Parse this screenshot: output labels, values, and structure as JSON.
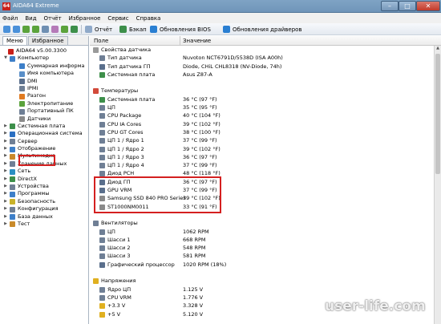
{
  "window": {
    "title": "AIDA64 Extreme",
    "app_icon": "64"
  },
  "menu": [
    "Файл",
    "Вид",
    "Отчёт",
    "Избранное",
    "Сервис",
    "Справка"
  ],
  "toolbar": {
    "report_label": "Отчёт",
    "backup_label": "Бэкап",
    "bios_label": "Обновления BIOS",
    "drivers_label": "Обновления драйверов"
  },
  "left_tabs": [
    "Меню",
    "Избранное"
  ],
  "tree": [
    {
      "label": "AIDA64 v5.00.3300",
      "level": 0,
      "icon": "aida-icon",
      "color": "#c8201a"
    },
    {
      "label": "Компьютер",
      "level": 1,
      "icon": "computer-icon",
      "color": "#3d7fc9",
      "exp": "▼"
    },
    {
      "label": "Суммарная информа",
      "level": 2,
      "icon": "info-icon",
      "color": "#3d7fc9"
    },
    {
      "label": "Имя компьютера",
      "level": 2,
      "icon": "computer-icon",
      "color": "#5a8fc8"
    },
    {
      "label": "DMI",
      "level": 2,
      "icon": "chip-icon",
      "color": "#5a6f8c"
    },
    {
      "label": "IPMI",
      "level": 2,
      "icon": "chip-icon",
      "color": "#6f7f95"
    },
    {
      "label": "Разгон",
      "level": 2,
      "icon": "flame-icon",
      "color": "#e07a20"
    },
    {
      "label": "Электропитание",
      "level": 2,
      "icon": "power-icon",
      "color": "#5ba33c"
    },
    {
      "label": "Портативный ПК",
      "level": 2,
      "icon": "laptop-icon",
      "color": "#6f7f95"
    },
    {
      "label": "Датчики",
      "level": 2,
      "icon": "sensor-icon",
      "color": "#8a8a8a"
    },
    {
      "label": "Системная плата",
      "level": 1,
      "icon": "motherboard-icon",
      "color": "#3d8f4a",
      "exp": "▶"
    },
    {
      "label": "Операционная система",
      "level": 1,
      "icon": "windows-icon",
      "color": "#2a6fc2",
      "exp": "▶"
    },
    {
      "label": "Сервер",
      "level": 1,
      "icon": "server-icon",
      "color": "#6f7f95",
      "exp": "▶"
    },
    {
      "label": "Отображение",
      "level": 1,
      "icon": "display-icon",
      "color": "#3d7fc9",
      "exp": "▶"
    },
    {
      "label": "Мультимедиа",
      "level": 1,
      "icon": "multimedia-icon",
      "color": "#c9882a",
      "exp": "▶"
    },
    {
      "label": "Хранение данных",
      "level": 1,
      "icon": "storage-icon",
      "color": "#6f7f95",
      "exp": "▶"
    },
    {
      "label": "Сеть",
      "level": 1,
      "icon": "network-icon",
      "color": "#2a8fc2",
      "exp": "▶"
    },
    {
      "label": "DirectX",
      "level": 1,
      "icon": "directx-icon",
      "color": "#3d8f4a",
      "exp": "▶"
    },
    {
      "label": "Устройства",
      "level": 1,
      "icon": "devices-icon",
      "color": "#6f7f95",
      "exp": "▶"
    },
    {
      "label": "Программы",
      "level": 1,
      "icon": "programs-icon",
      "color": "#3d7fc9",
      "exp": "▶"
    },
    {
      "label": "Безопасность",
      "level": 1,
      "icon": "security-icon",
      "color": "#c9b22a",
      "exp": "▶"
    },
    {
      "label": "Конфигурация",
      "level": 1,
      "icon": "config-icon",
      "color": "#6f7f95",
      "exp": "▶"
    },
    {
      "label": "База данных",
      "level": 1,
      "icon": "database-icon",
      "color": "#3d7fc9",
      "exp": "▶"
    },
    {
      "label": "Тест",
      "level": 1,
      "icon": "test-icon",
      "color": "#c98a2a",
      "exp": "▶"
    }
  ],
  "columns": {
    "field": "Поле",
    "value": "Значение"
  },
  "rows": [
    {
      "type": "group",
      "field": "Свойства датчика",
      "icon": "sensor-icon",
      "color": "#9a9a9a"
    },
    {
      "field": "Тип датчика",
      "value": "Nuvoton NCT6791D/5538D  (ISA A00h)",
      "icon": "chip-icon",
      "color": "#6f7f95"
    },
    {
      "field": "Тип датчика ГП",
      "value": "Diode, CHiL CHL8318  (NV-Diode, 74h)",
      "icon": "gpu-icon",
      "color": "#5a6f8c"
    },
    {
      "field": "Системная плата",
      "value": "Asus Z87-A",
      "icon": "motherboard-icon",
      "color": "#3d8f4a"
    },
    {
      "type": "blank"
    },
    {
      "type": "group",
      "field": "Температуры",
      "icon": "thermometer-icon",
      "color": "#d24a3a"
    },
    {
      "field": "Системная плата",
      "value": "36 °C  (97 °F)",
      "icon": "motherboard-icon",
      "color": "#3d8f4a"
    },
    {
      "field": "ЦП",
      "value": "35 °C  (95 °F)",
      "icon": "cpu-icon",
      "color": "#6f7f95"
    },
    {
      "field": "CPU Package",
      "value": "40 °C  (104 °F)",
      "icon": "cpu-icon",
      "color": "#6f7f95"
    },
    {
      "field": "CPU IA Cores",
      "value": "39 °C  (102 °F)",
      "icon": "cpu-icon",
      "color": "#6f7f95"
    },
    {
      "field": "CPU GT Cores",
      "value": "38 °C  (100 °F)",
      "icon": "cpu-icon",
      "color": "#6f7f95"
    },
    {
      "field": "ЦП 1 / Ядро 1",
      "value": "37 °C  (99 °F)",
      "icon": "cpu-icon",
      "color": "#6f7f95"
    },
    {
      "field": "ЦП 1 / Ядро 2",
      "value": "39 °C  (102 °F)",
      "icon": "cpu-icon",
      "color": "#6f7f95"
    },
    {
      "field": "ЦП 1 / Ядро 3",
      "value": "36 °C  (97 °F)",
      "icon": "cpu-icon",
      "color": "#6f7f95"
    },
    {
      "field": "ЦП 1 / Ядро 4",
      "value": "37 °C  (99 °F)",
      "icon": "cpu-icon",
      "color": "#6f7f95"
    },
    {
      "field": "Диод PCH",
      "value": "48 °C  (118 °F)",
      "icon": "chip-icon",
      "color": "#6f7f95"
    },
    {
      "field": "Диод ГП",
      "value": "36 °C  (97 °F)",
      "icon": "gpu-icon",
      "color": "#5a6f8c"
    },
    {
      "field": "GPU VRM",
      "value": "37 °C  (99 °F)",
      "icon": "gpu-icon",
      "color": "#5a6f8c"
    },
    {
      "field": "Samsung SSD 840 PRO Series",
      "value": "39 °C  (102 °F)",
      "icon": "drive-icon",
      "color": "#8a8a8a"
    },
    {
      "field": "ST1000NM0011",
      "value": "33 °C  (91 °F)",
      "icon": "drive-icon",
      "color": "#8a8a8a"
    },
    {
      "type": "blank"
    },
    {
      "type": "group",
      "field": "Вентиляторы",
      "icon": "fan-icon",
      "color": "#6f7f95"
    },
    {
      "field": "ЦП",
      "value": "1062 RPM",
      "icon": "fan-icon",
      "color": "#6f7f95"
    },
    {
      "field": "Шасси 1",
      "value": "668 RPM",
      "icon": "fan-icon",
      "color": "#6f7f95"
    },
    {
      "field": "Шасси 2",
      "value": "548 RPM",
      "icon": "fan-icon",
      "color": "#6f7f95"
    },
    {
      "field": "Шасси 3",
      "value": "581 RPM",
      "icon": "fan-icon",
      "color": "#6f7f95"
    },
    {
      "field": "Графический процессор",
      "value": "1020 RPM  (18%)",
      "icon": "gpu-icon",
      "color": "#5a6f8c"
    },
    {
      "type": "blank"
    },
    {
      "type": "group",
      "field": "Напряжения",
      "icon": "voltage-icon",
      "color": "#e0b020"
    },
    {
      "field": "Ядро ЦП",
      "value": "1.125 V",
      "icon": "cpu-icon",
      "color": "#6f7f95"
    },
    {
      "field": "CPU VRM",
      "value": "1.776 V",
      "icon": "cpu-icon",
      "color": "#6f7f95"
    },
    {
      "field": "+3.3 V",
      "value": "3.328 V",
      "icon": "voltage-icon",
      "color": "#e0b020"
    },
    {
      "field": "+5 V",
      "value": "5.120 V",
      "icon": "voltage-icon",
      "color": "#e0b020"
    }
  ],
  "watermark": "user-life.com"
}
